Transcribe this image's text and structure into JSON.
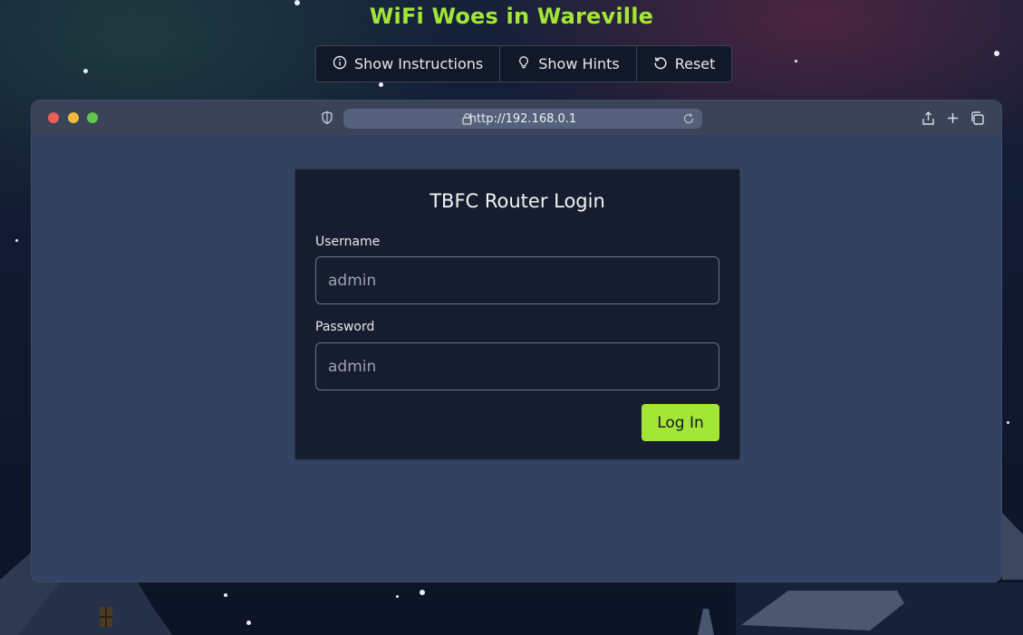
{
  "app": {
    "title": "WiFi Woes in Wareville"
  },
  "toolbar": {
    "instructions_label": "Show Instructions",
    "hints_label": "Show Hints",
    "reset_label": "Reset"
  },
  "browser": {
    "url": "http://192.168.0.1",
    "traffic_lights": {
      "close": "#ec5f57",
      "minimize": "#f2bb3d",
      "maximize": "#5fc84a"
    }
  },
  "login": {
    "title": "TBFC Router Login",
    "username_label": "Username",
    "username_placeholder": "admin",
    "password_label": "Password",
    "password_placeholder": "admin",
    "submit_label": "Log In"
  },
  "theme": {
    "accent": "#a3e635",
    "card_bg": "#161d2e",
    "page_bg": "#334261"
  }
}
